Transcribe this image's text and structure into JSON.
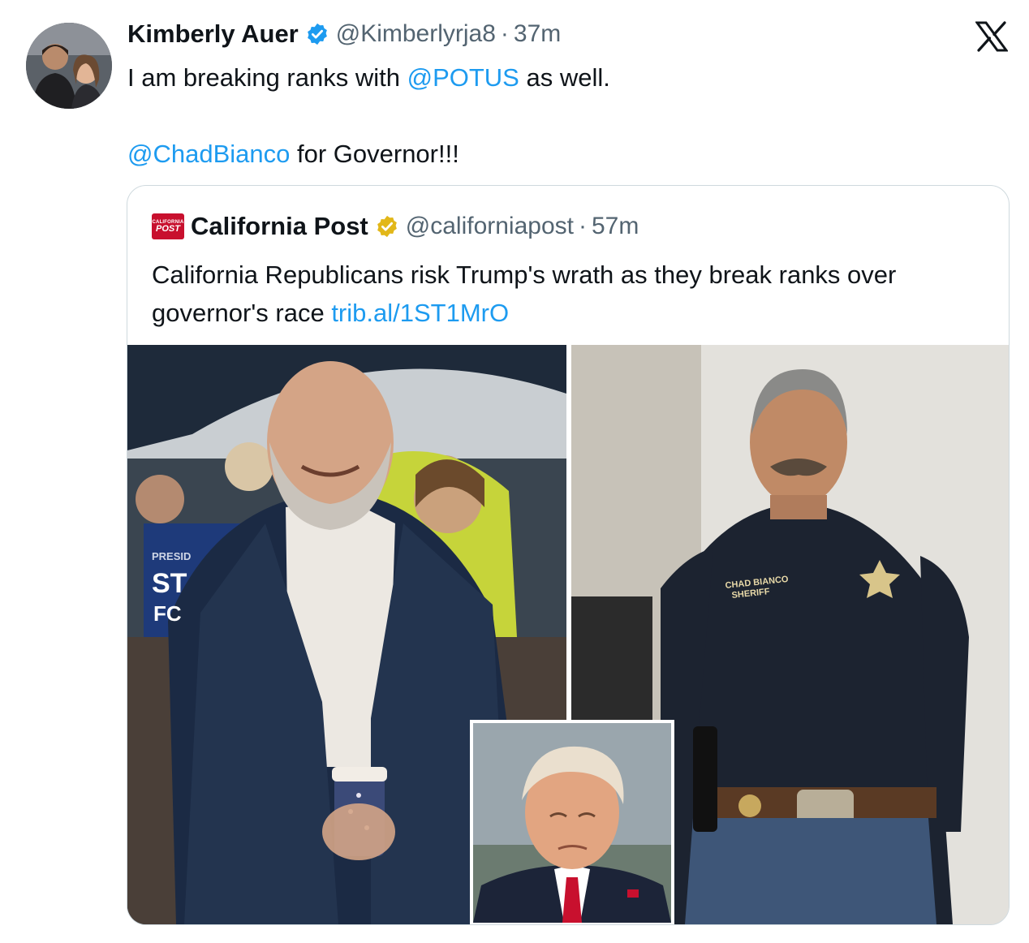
{
  "tweet": {
    "author_name": "Kimberly Auer",
    "handle": "@Kimberlyrja8",
    "separator": "·",
    "time": "37m",
    "text_line1_prefix": "I am breaking ranks with ",
    "mention_potus": "@POTUS",
    "text_line1_suffix": " as well.",
    "mention_chad": "@ChadBianco",
    "text_line3_suffix": " for Governor!!!"
  },
  "quote": {
    "logo_line1": "CALIFORNIA",
    "logo_line2": "POST",
    "name": "California Post",
    "handle": "@californiapost",
    "separator": "·",
    "time": "57m",
    "text": "California Republicans risk Trump's wrath as they break ranks over governor's race ",
    "link": "trib.al/1ST1MrO"
  },
  "media": {
    "badge_text_line1": "CHAD BIANCO",
    "badge_text_line2": "SHERIFF",
    "sign_text1": "PRESID",
    "sign_text2": "ST",
    "sign_text3": "FC"
  },
  "icons": {
    "verified_color": "#1d9bf0",
    "gold_verified_color": "#e2b719",
    "x_logo": "x-logo-icon"
  }
}
